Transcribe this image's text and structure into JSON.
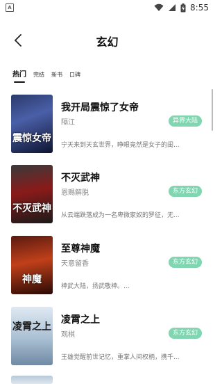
{
  "status": {
    "time": "8:55"
  },
  "header": {
    "title": "玄幻"
  },
  "tabs": [
    {
      "label": "热门",
      "active": true
    },
    {
      "label": "完结"
    },
    {
      "label": "新书"
    },
    {
      "label": "口碑"
    }
  ],
  "books": [
    {
      "title": "我开局震惊了女帝",
      "author": "隔江",
      "tag": "异界大陆",
      "desc": "宁天来到天玄世界，睁眼竟然是女子的闺...",
      "cover_text": "震惊女帝"
    },
    {
      "title": "不灭武神",
      "author": "恩赐解脱",
      "tag": "东方玄幻",
      "desc": "从云端跌落成为一名卑微家奴的罗征，无...",
      "cover_text": "不灭武神"
    },
    {
      "title": "至尊神魔",
      "author": "天意留香",
      "tag": "东方玄幻",
      "desc": "神武大陆，扬武敬神。...",
      "cover_text": "神魔"
    },
    {
      "title": "凌霄之上",
      "author": "观棋",
      "tag": "东方玄幻",
      "desc": "王雄觉醒前世记忆，重掌人间权柄，携千...",
      "cover_text": "凌霄之上"
    }
  ],
  "colors": {
    "tag_bg": "#7fd6b0"
  }
}
